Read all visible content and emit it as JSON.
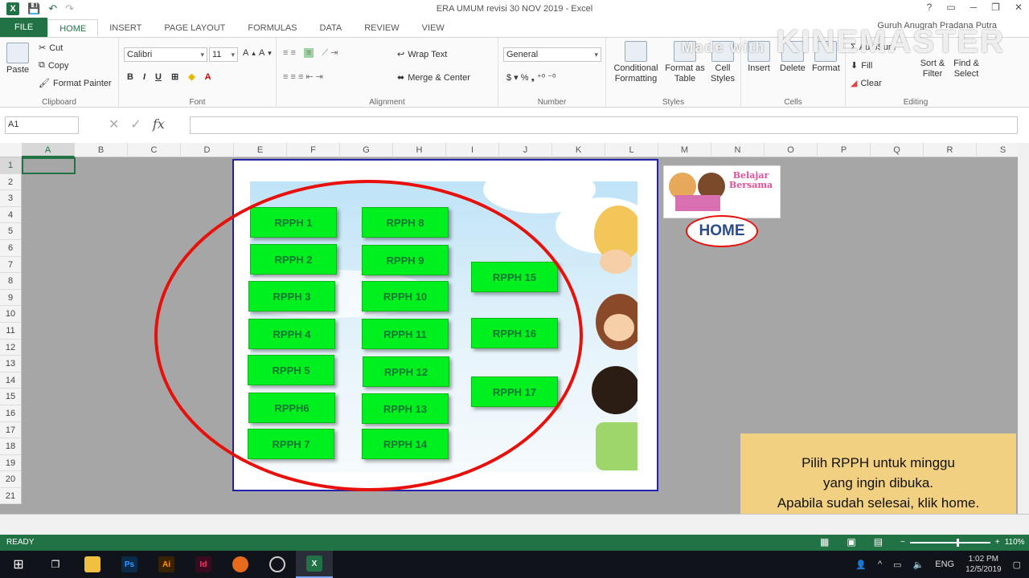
{
  "window": {
    "title": "ERA UMUM revisi 30 NOV 2019 - Excel",
    "controls": [
      "?",
      "▭",
      "─",
      "❐",
      "✕"
    ]
  },
  "tabs": [
    "FILE",
    "HOME",
    "INSERT",
    "PAGE LAYOUT",
    "FORMULAS",
    "DATA",
    "REVIEW",
    "VIEW"
  ],
  "user": "Guruh Anugrah Pradana Putra",
  "watermark": {
    "small": "Made with",
    "big": "KINEMASTER"
  },
  "ribbon": {
    "clipboard": {
      "paste": "Paste",
      "cut": "Cut",
      "copy": "Copy",
      "format_painter": "Format Painter",
      "label": "Clipboard"
    },
    "font": {
      "name": "Calibri",
      "size": "11",
      "label": "Font"
    },
    "alignment": {
      "wrap": "Wrap Text",
      "merge": "Merge & Center",
      "label": "Alignment"
    },
    "number": {
      "format": "General",
      "label": "Number"
    },
    "styles": {
      "conditional": "Conditional Formatting",
      "format_table": "Format as Table",
      "cell_styles": "Cell Styles",
      "label": "Styles"
    },
    "cells": {
      "insert": "Insert",
      "delete": "Delete",
      "format": "Format",
      "label": "Cells"
    },
    "editing": {
      "autosum": "AutoSum",
      "fill": "Fill",
      "clear": "Clear",
      "sort": "Sort & Filter",
      "find": "Find & Select",
      "label": "Editing"
    }
  },
  "namebox": "A1",
  "columns": [
    "A",
    "B",
    "C",
    "D",
    "E",
    "F",
    "G",
    "H",
    "I",
    "J",
    "K",
    "L",
    "M",
    "N",
    "O",
    "P",
    "Q",
    "R",
    "S"
  ],
  "rows": [
    "1",
    "2",
    "3",
    "4",
    "5",
    "6",
    "7",
    "8",
    "9",
    "10",
    "11",
    "12",
    "13",
    "14",
    "15",
    "16",
    "17",
    "18",
    "19",
    "20",
    "21"
  ],
  "rpph_buttons": [
    "RPPH 1",
    "RPPH 2",
    "RPPH 3",
    "RPPH 4",
    "RPPH 5",
    "RPPH6",
    "RPPH 7",
    "RPPH 8",
    "RPPH 9",
    "RPPH 10",
    "RPPH 11",
    "RPPH 12",
    "RPPH 13",
    "RPPH 14",
    "RPPH 15",
    "RPPH 16",
    "RPPH 17"
  ],
  "logo_text": "Belajar Bersama",
  "home_button": "HOME",
  "note": {
    "line1": "Pilih RPPH untuk minggu",
    "line2": "yang ingin dibuka.",
    "line3": "Apabila sudah selesai, klik home."
  },
  "status": {
    "ready": "READY",
    "zoom": "110%"
  },
  "taskbar": {
    "lang": "ENG",
    "time": "1:02 PM",
    "date": "12/5/2019"
  }
}
